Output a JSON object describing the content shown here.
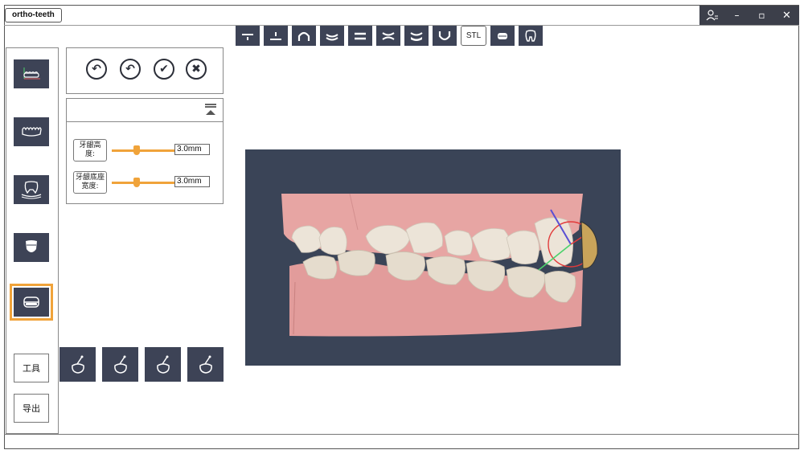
{
  "app": {
    "title": "ortho-teeth",
    "window_controls": [
      "user-switch",
      "minimize",
      "restore",
      "close"
    ],
    "window_glyphs": {
      "minimize": "–",
      "restore": "▫",
      "close": "✕"
    }
  },
  "toolbar_top": {
    "icons": [
      "occlusion-plane-icon",
      "midline-icon",
      "arch-icon",
      "lower-arch-icon",
      "parallel-lines-icon",
      "converge-lines-icon",
      "curve-tray-icon",
      "u-shape-icon",
      "stl-label",
      "gum-icon",
      "tooth-outline-icon"
    ],
    "stl_label": "STL"
  },
  "sidebar": {
    "items": [
      {
        "icon": "axis-teeth-icon",
        "active": false
      },
      {
        "icon": "teeth-row-icon",
        "active": false
      },
      {
        "icon": "tooth-root-icon",
        "active": false
      },
      {
        "icon": "crown-icon",
        "active": false
      },
      {
        "icon": "gum-band-icon",
        "active": true
      }
    ],
    "tools_label": "工具",
    "export_label": "导出"
  },
  "actions": {
    "undo_label": "↶",
    "redo_label": "↶",
    "confirm_label": "✔",
    "cancel_label": "✖"
  },
  "params": {
    "gum_height": {
      "label": "牙龈高度:",
      "value": "3.0mm",
      "slider_fraction": 0.35
    },
    "gum_base_width": {
      "label": "牙龈底座宽度:",
      "value": "3.0mm",
      "slider_fraction": 0.35
    }
  },
  "bottom_tools": [
    "tooth-pick-icon",
    "tooth-pick-icon",
    "tooth-pick-icon",
    "tooth-pick-icon"
  ],
  "colors": {
    "accent": "#f0a33a",
    "button_dark": "#3d4356",
    "viewport_bg": "#3a4457",
    "gum": "#e7a5a3",
    "tooth": "#ece4d8"
  }
}
